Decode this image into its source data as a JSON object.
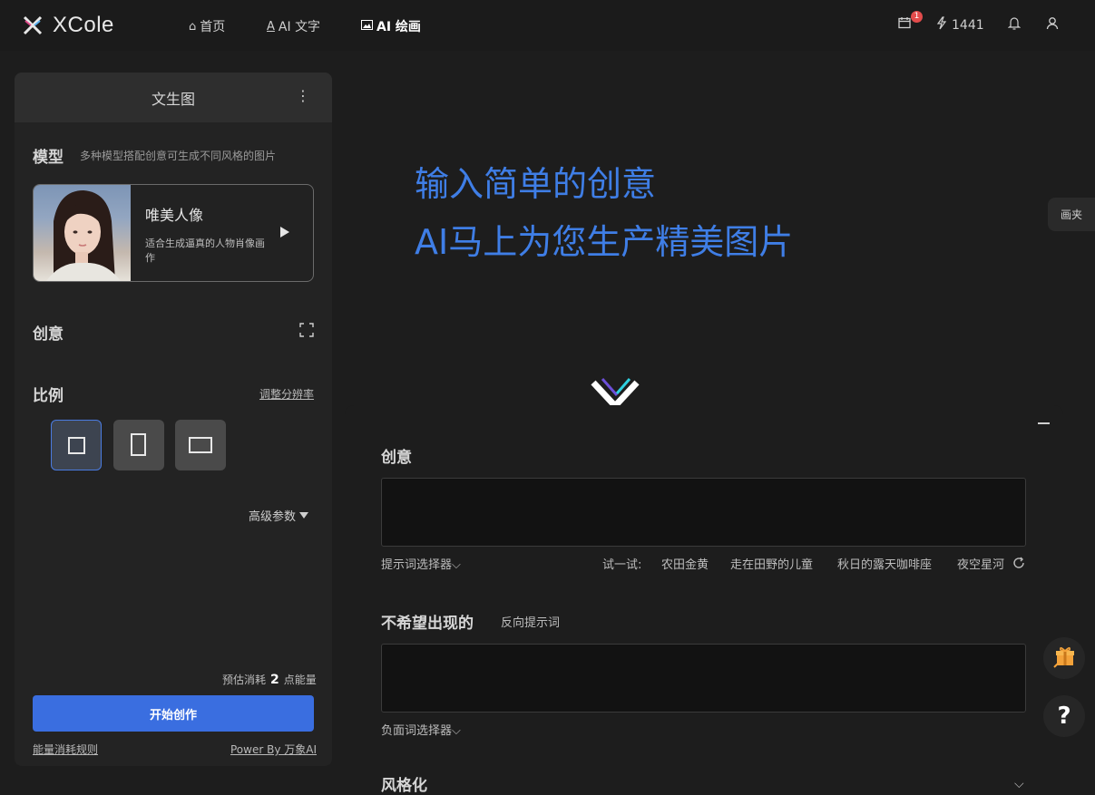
{
  "app": {
    "brand": "XCole"
  },
  "nav": [
    {
      "label": "首页",
      "icon": "home-icon"
    },
    {
      "label": "AI 文字",
      "icon": "text-icon"
    },
    {
      "label": "AI 绘画",
      "icon": "image-icon",
      "active": true
    }
  ],
  "toolbar": {
    "calendar_badge": "1",
    "energy": "1441"
  },
  "left_panel": {
    "title": "文生图",
    "model_section": {
      "title": "模型",
      "subtitle": "多种模型搭配创意可生成不同风格的图片",
      "card_name": "唯美人像",
      "card_desc": "适合生成逼真的人物肖像画作"
    },
    "idea_title": "创意",
    "ratio": {
      "title": "比例",
      "link": "调整分辨率"
    },
    "advanced": "高级参数",
    "cost_prefix": "预估消耗",
    "cost_value": "2",
    "cost_suffix": "点能量",
    "start_button": "开始创作",
    "rules_link": "能量消耗规则",
    "powered_by": "Power By 万象AI"
  },
  "hero": {
    "line1": "输入简单的创意",
    "line2": "AI马上为您生产精美图片"
  },
  "drawer_tab": "画夹",
  "bottom_panel": {
    "idea_title": "创意",
    "prompt_selector": "提示词选择器",
    "try_label": "试一试:",
    "suggestions": [
      "农田金黄",
      "走在田野的儿童",
      "秋日的露天咖啡座",
      "夜空星河"
    ],
    "negative_title": "不希望出现的",
    "negative_sub": "反向提示词",
    "negative_selector": "负面词选择器",
    "style_title": "风格化"
  },
  "colors": {
    "accent": "#3a6ee0",
    "hero_text": "#3f7ee6",
    "badge": "#e34c4c"
  }
}
